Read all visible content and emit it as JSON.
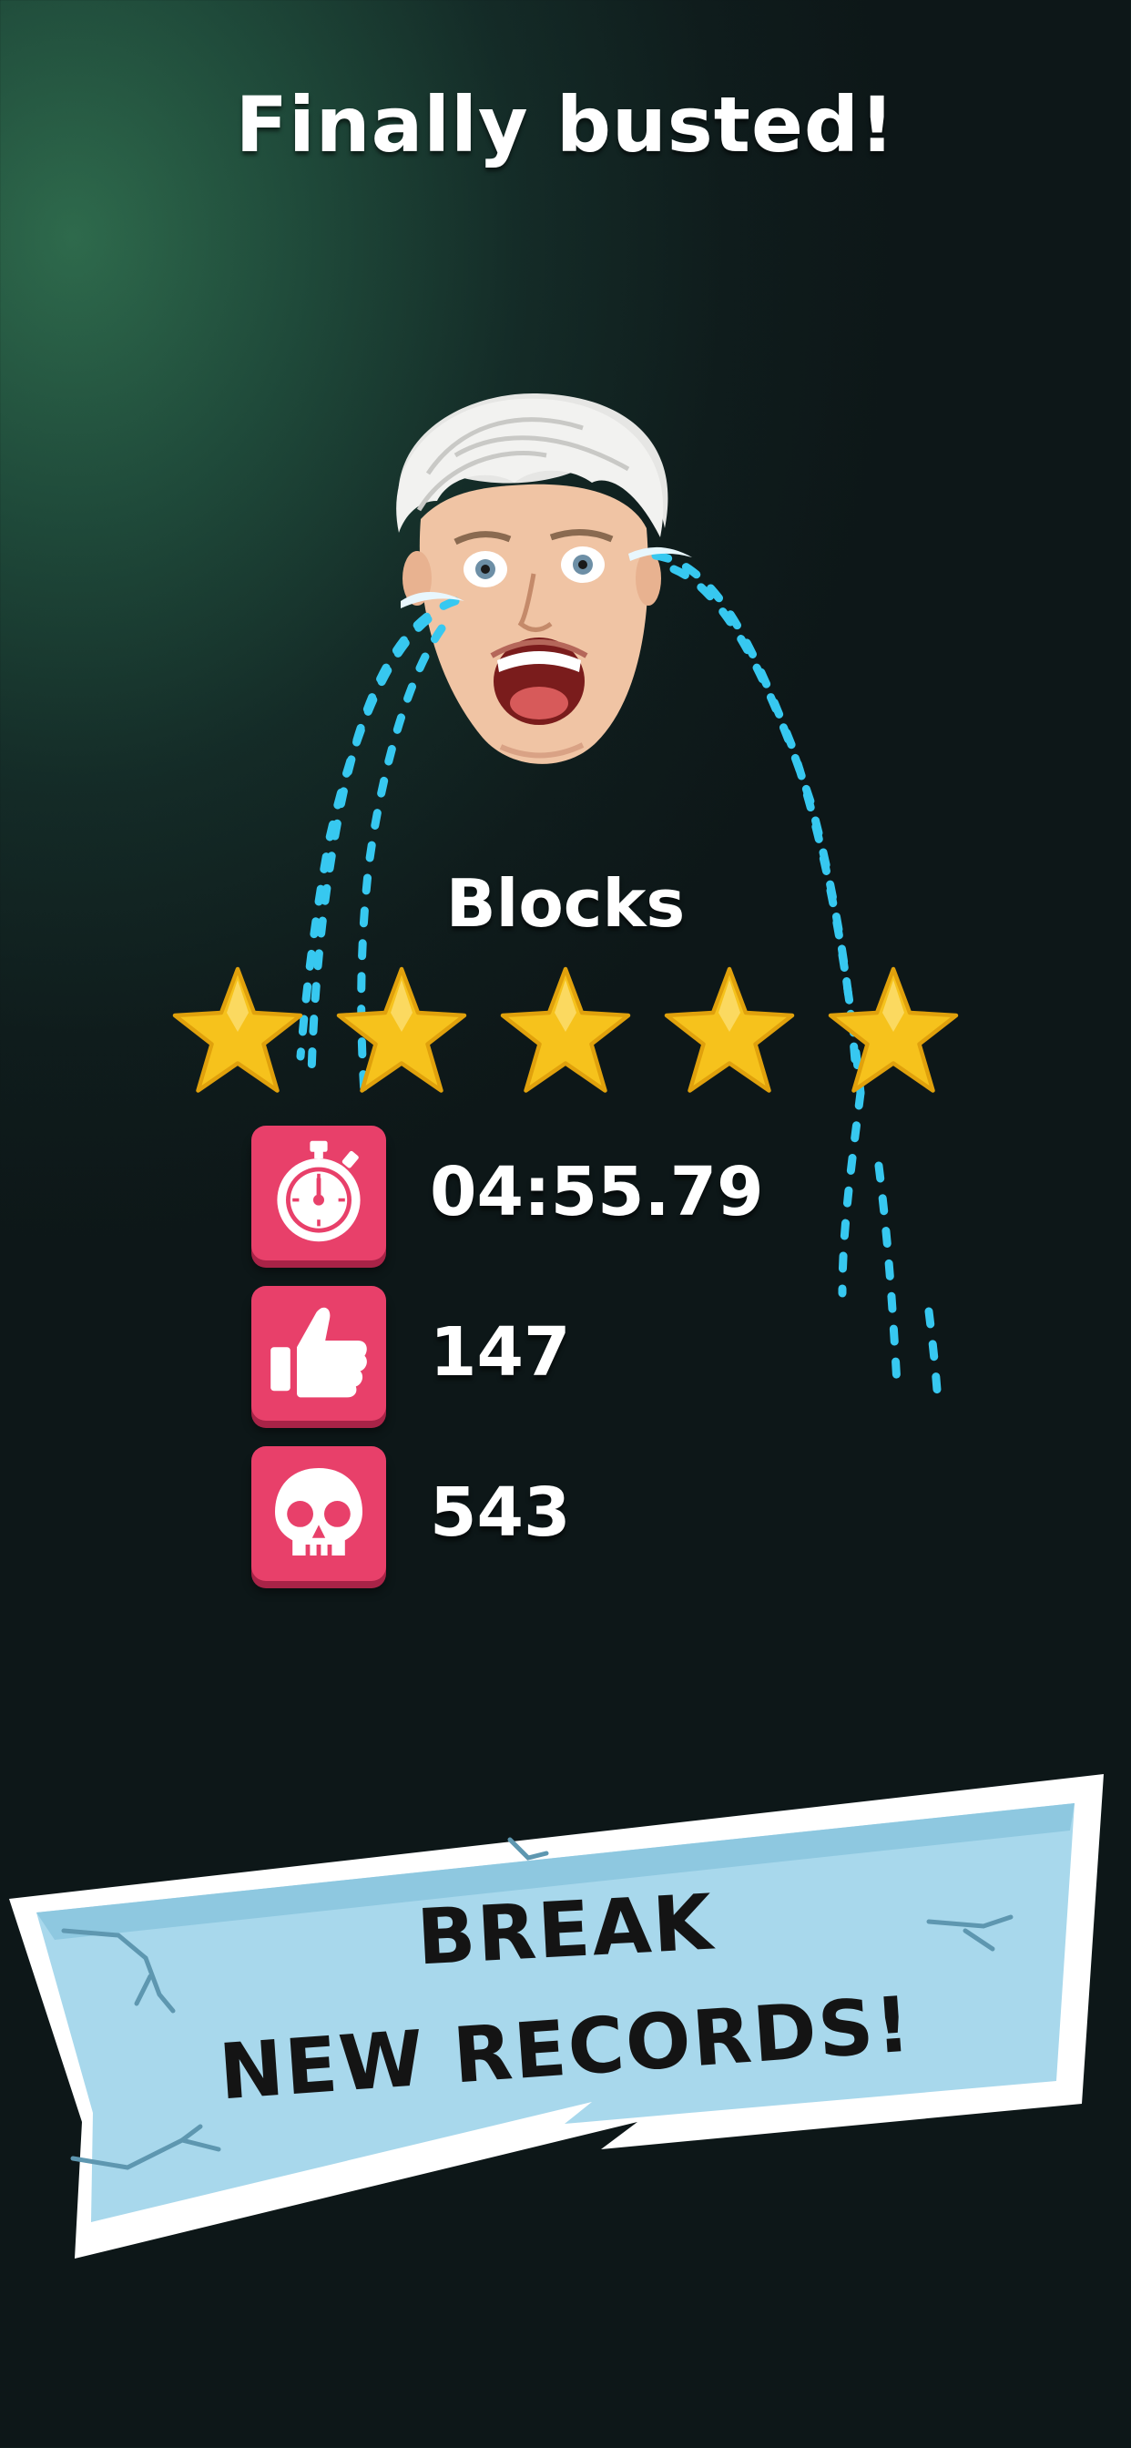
{
  "screen": {
    "title": "Finally busted!",
    "level_name": "Blocks",
    "rating": {
      "stars_earned": 5,
      "stars_total": 5
    }
  },
  "stats": {
    "time": {
      "icon": "stopwatch-icon",
      "value": "04:55.79"
    },
    "likes": {
      "icon": "thumbs-up-icon",
      "value": "147"
    },
    "deaths": {
      "icon": "skull-icon",
      "value": "543"
    }
  },
  "banner": {
    "line1": "BREAK",
    "line2": "NEW RECORDS!"
  },
  "colors": {
    "star": "#f6c21c",
    "stat_tile": "#e8406a",
    "banner": "#a8d8ec",
    "tears": "#37c8f0"
  }
}
